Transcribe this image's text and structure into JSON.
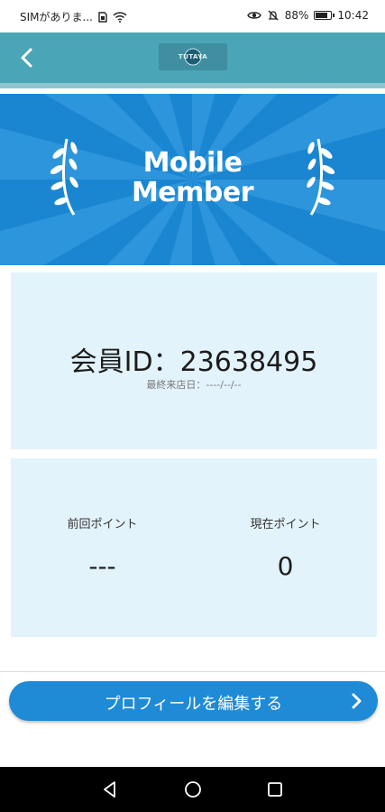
{
  "status_bar": {
    "carrier": "SIMがありま...",
    "battery": "88%",
    "battery_level": 0.88,
    "time": "10:42",
    "icons": [
      "sim-icon",
      "wifi-icon",
      "eye-comfort-icon",
      "bell-off-icon",
      "battery-icon"
    ]
  },
  "app_bar": {
    "logo_text": "TUTAYA",
    "back_icon": "chevron-left-icon",
    "color": "#4aa6b6"
  },
  "banner": {
    "line1": "Mobile",
    "line2": "Member",
    "color": "#1a86d1",
    "icons": [
      "laurel-left-icon",
      "laurel-right-icon"
    ]
  },
  "member": {
    "id_text": "会員ID：23638495",
    "last_visit": "最終来店日：----/--/--"
  },
  "points": {
    "previous_label": "前回ポイント",
    "previous_value": "---",
    "current_label": "現在ポイント",
    "current_value": "0"
  },
  "edit_profile": {
    "label": "プロフィールを編集する",
    "color": "#1f8ad6"
  },
  "nav": {
    "icons": [
      "back-icon",
      "home-icon",
      "recents-icon"
    ]
  }
}
